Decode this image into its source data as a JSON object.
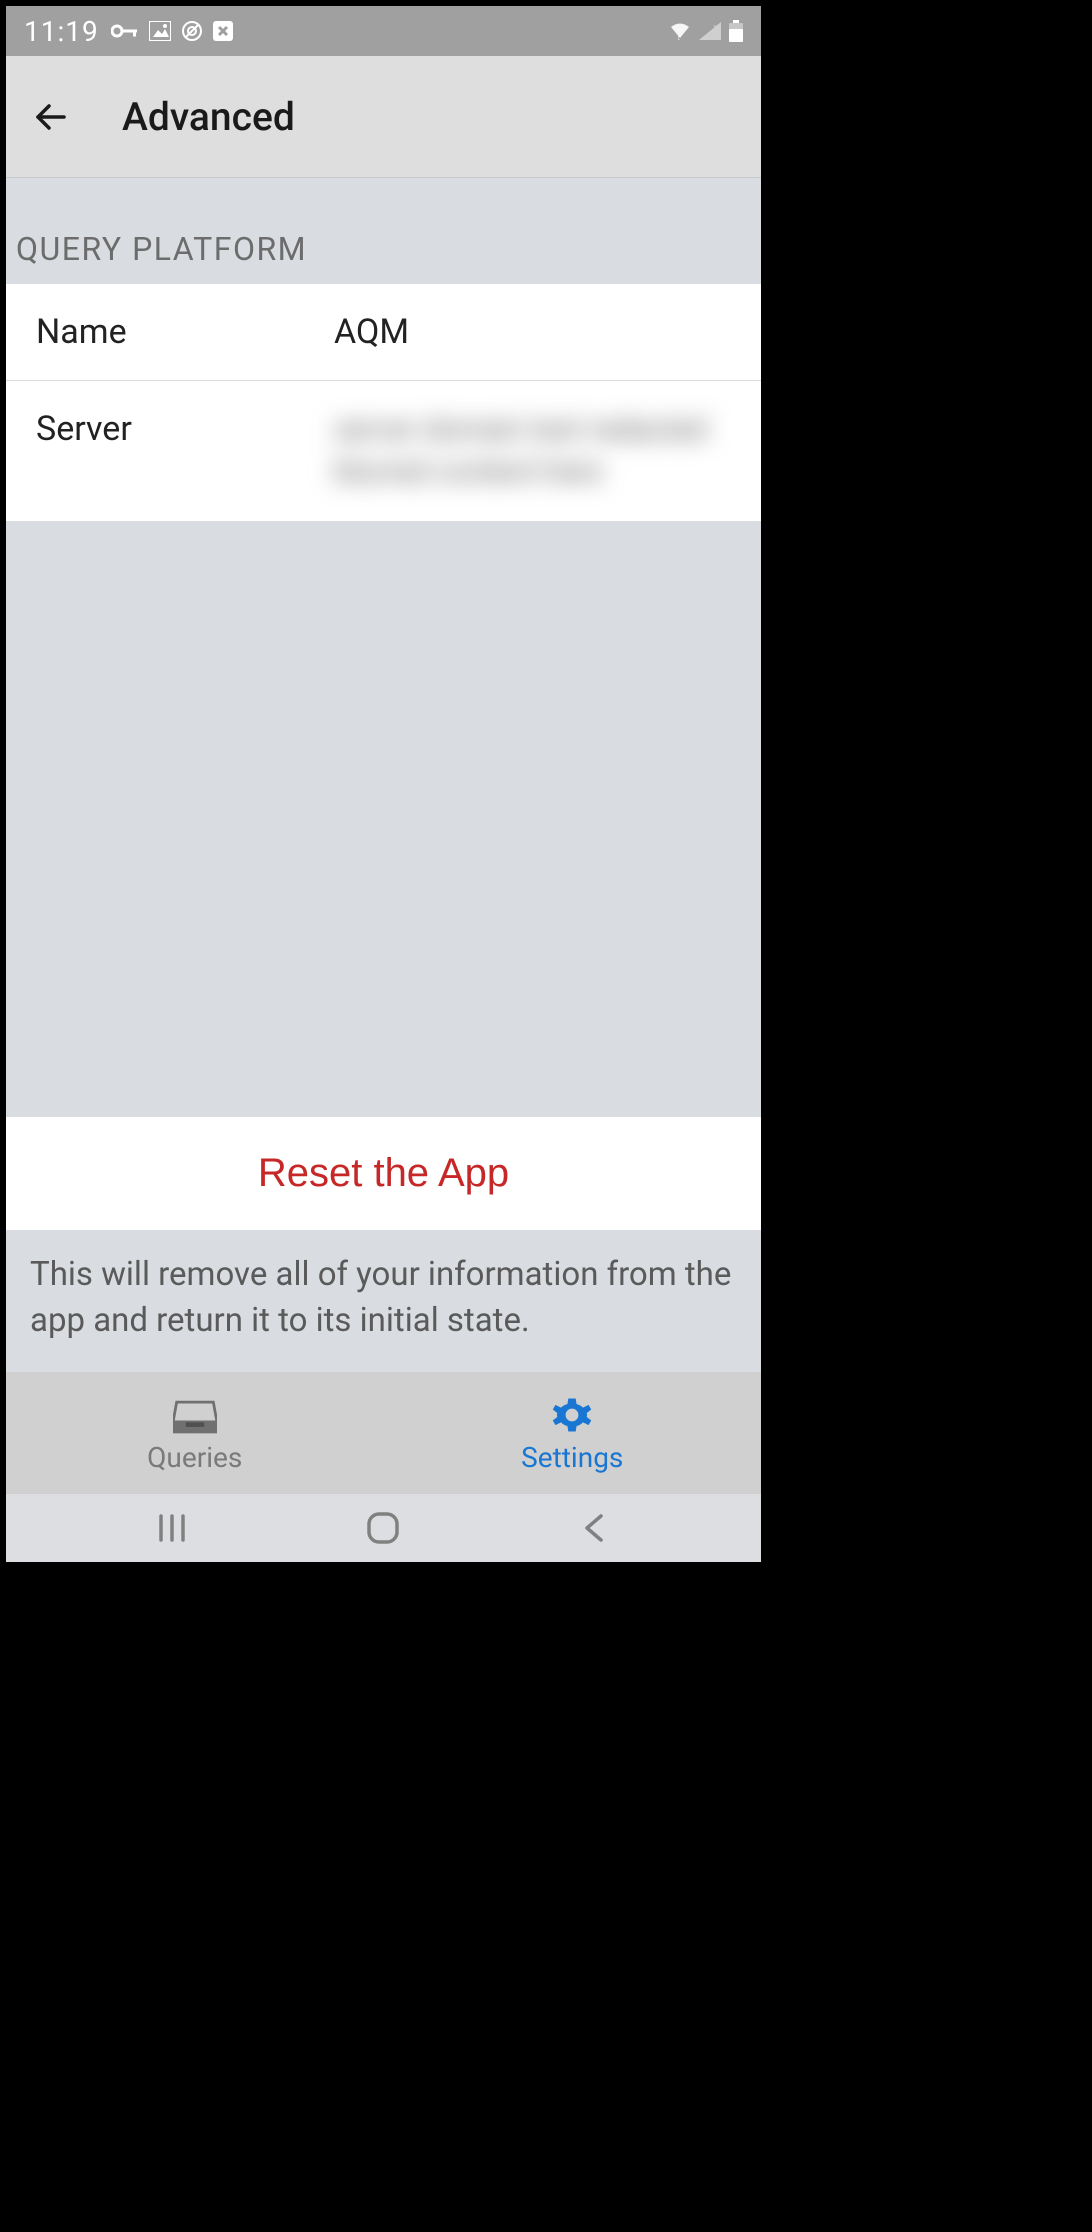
{
  "status": {
    "time": "11:19"
  },
  "header": {
    "title": "Advanced"
  },
  "section": {
    "title": "QUERY PLATFORM"
  },
  "settings": {
    "name_label": "Name",
    "name_value": "AQM",
    "server_label": "Server",
    "server_value": "server domain text redacted blurred content here"
  },
  "reset": {
    "button_label": "Reset the App",
    "description": "This will remove all of your information from the app and return it to its initial state."
  },
  "nav": {
    "queries_label": "Queries",
    "settings_label": "Settings"
  }
}
